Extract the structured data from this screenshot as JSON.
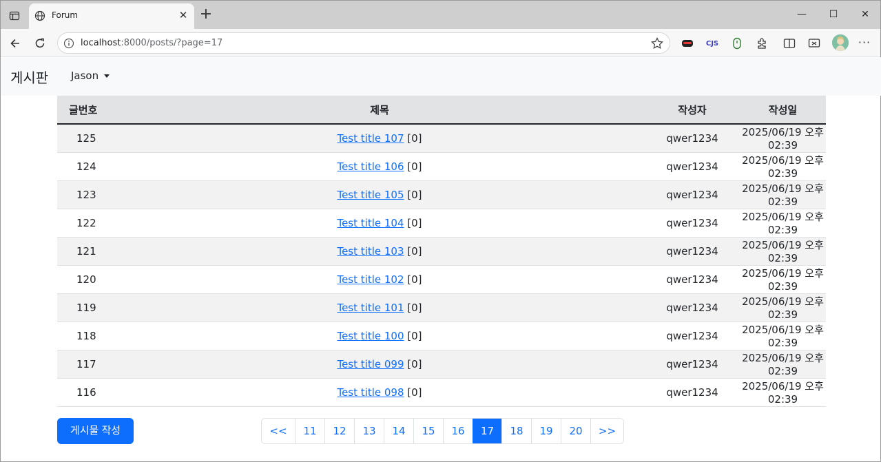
{
  "browser": {
    "tab_title": "Forum",
    "url_host": "localhost",
    "url_rest": ":8000/posts/?page=17",
    "window_controls": [
      "minimize-icon",
      "maximize-icon",
      "close-icon"
    ]
  },
  "navbar": {
    "brand": "게시판",
    "user": "Jason"
  },
  "table": {
    "headers": [
      "글번호",
      "제목",
      "작성자",
      "작성일"
    ],
    "rows": [
      {
        "num": "125",
        "title": "Test title 107",
        "comments": "[0]",
        "author": "qwer1234",
        "date": "2025/06/19 오후 02:39"
      },
      {
        "num": "124",
        "title": "Test title 106",
        "comments": "[0]",
        "author": "qwer1234",
        "date": "2025/06/19 오후 02:39"
      },
      {
        "num": "123",
        "title": "Test title 105",
        "comments": "[0]",
        "author": "qwer1234",
        "date": "2025/06/19 오후 02:39"
      },
      {
        "num": "122",
        "title": "Test title 104",
        "comments": "[0]",
        "author": "qwer1234",
        "date": "2025/06/19 오후 02:39"
      },
      {
        "num": "121",
        "title": "Test title 103",
        "comments": "[0]",
        "author": "qwer1234",
        "date": "2025/06/19 오후 02:39"
      },
      {
        "num": "120",
        "title": "Test title 102",
        "comments": "[0]",
        "author": "qwer1234",
        "date": "2025/06/19 오후 02:39"
      },
      {
        "num": "119",
        "title": "Test title 101",
        "comments": "[0]",
        "author": "qwer1234",
        "date": "2025/06/19 오후 02:39"
      },
      {
        "num": "118",
        "title": "Test title 100",
        "comments": "[0]",
        "author": "qwer1234",
        "date": "2025/06/19 오후 02:39"
      },
      {
        "num": "117",
        "title": "Test title 099",
        "comments": "[0]",
        "author": "qwer1234",
        "date": "2025/06/19 오후 02:39"
      },
      {
        "num": "116",
        "title": "Test title 098",
        "comments": "[0]",
        "author": "qwer1234",
        "date": "2025/06/19 오후 02:39"
      }
    ]
  },
  "write_button": "게시물 작성",
  "pagination": {
    "prev": "<<",
    "pages": [
      "11",
      "12",
      "13",
      "14",
      "15",
      "16",
      "17",
      "18",
      "19",
      "20"
    ],
    "active": "17",
    "next": ">>"
  },
  "colors": {
    "primary": "#0d6efd",
    "header_bg": "#e2e3e5",
    "stripe": "#f2f2f2",
    "navbar_bg": "#f8f9fa"
  }
}
